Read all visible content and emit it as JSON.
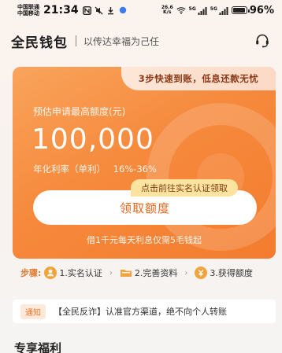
{
  "status_bar": {
    "carrier_1": "中国联通",
    "carrier_2": "中国移动",
    "time": "21:34",
    "net_speed_value": "26.6",
    "net_speed_unit": "K/s",
    "sig1_label": "5G",
    "sig2_label": "5G",
    "battery_percent": "96%",
    "battery_level": 0.96
  },
  "header": {
    "brand": "全民钱包",
    "slogan": "以传达幸福为己任"
  },
  "card": {
    "promo": "3步快速到账，低息还款无忧",
    "limit_label": "预估申请最高额度(元)",
    "limit_amount": "100,000",
    "rate_label": "年化利率（单利）",
    "rate_value": "16%-36%",
    "tip": "点击前往实名认证领取",
    "claim_button": "领取额度",
    "interest_note": "借1千元每天利息仅需5毛钱起"
  },
  "steps": {
    "label": "步骤:",
    "items": [
      {
        "label": "1.实名认证",
        "icon": "profile-icon",
        "color": "#f3a33b"
      },
      {
        "label": "2.完善资料",
        "icon": "folder-icon",
        "color": "#f3a33b"
      },
      {
        "label": "3.获得额度",
        "icon": "yen-coin-icon",
        "color": "#f3a33b"
      }
    ]
  },
  "notice": {
    "badge": "通知",
    "text": "【全民反诈】认准官方渠道，绝不向个人转账"
  },
  "section": {
    "title": "专享福利"
  },
  "colors": {
    "accent": "#f47c2e",
    "card_start": "#f9a45c",
    "button_text": "#e9661d"
  }
}
